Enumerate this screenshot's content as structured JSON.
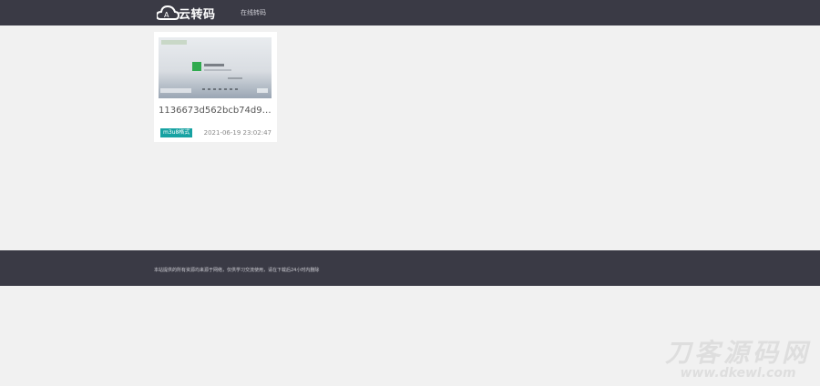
{
  "header": {
    "logo_text": "云转码",
    "nav_link": "在线转码"
  },
  "video_card": {
    "title": "1136673d562bcb74d933ba5...",
    "badge": "m3u8格式",
    "date": "2021-06-19 23:02:47"
  },
  "footer": {
    "text": "本站提供的所有资源均来源于网络，仅供学习交流使用，请在下载后24小时内删除"
  },
  "watermark": {
    "title": "刀客源码网",
    "url": "www.dkewl.com"
  },
  "colors": {
    "header_bg": "#3a3a45",
    "page_bg": "#f1f1f1",
    "badge_bg": "#17a2a2"
  }
}
